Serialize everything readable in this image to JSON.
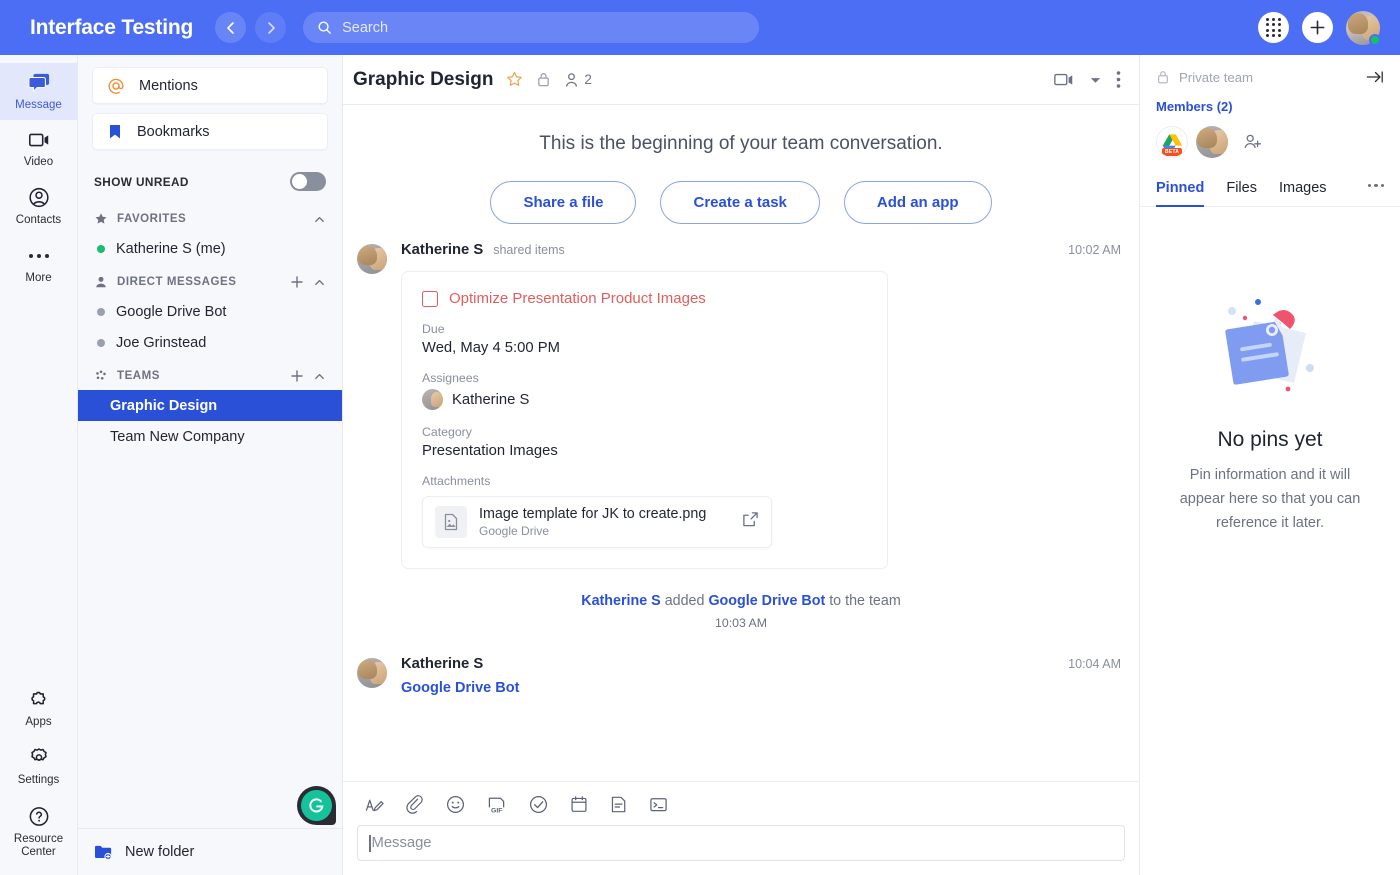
{
  "topbar": {
    "brand": "Interface Testing",
    "back_icon": "chevron-left-icon",
    "forward_icon": "chevron-right-icon",
    "search_placeholder": "Search",
    "search_value": "",
    "search_icon": "search-icon",
    "dialpad_icon": "dialpad-icon",
    "add_icon": "plus-icon",
    "avatar_name": "user-avatar",
    "status": "online",
    "accent": "#4c6ef5"
  },
  "rail": {
    "items": [
      {
        "label": "Message",
        "icon": "message-icon",
        "active": true
      },
      {
        "label": "Video",
        "icon": "video-icon",
        "active": false
      },
      {
        "label": "Contacts",
        "icon": "contacts-icon",
        "active": false
      },
      {
        "label": "More",
        "icon": "more-dots-icon",
        "active": false
      }
    ],
    "bottom_items": [
      {
        "label": "Apps",
        "icon": "puzzle-icon"
      },
      {
        "label": "Settings",
        "icon": "gear-icon"
      },
      {
        "label": "Resource Center",
        "icon": "question-circle-icon"
      }
    ]
  },
  "sidebar": {
    "mentions_label": "Mentions",
    "mentions_icon": "at-sign-icon",
    "bookmarks_label": "Bookmarks",
    "bookmarks_icon": "bookmark-icon",
    "show_unread_label": "SHOW UNREAD",
    "show_unread_on": false,
    "groups": [
      {
        "title": "FAVORITES",
        "icon": "star-icon",
        "has_add": false,
        "items": [
          {
            "name": "Katherine S (me)",
            "presence": "online"
          }
        ]
      },
      {
        "title": "DIRECT MESSAGES",
        "icon": "person-icon",
        "has_add": true,
        "items": [
          {
            "name": "Google Drive Bot",
            "presence": "offline"
          },
          {
            "name": "Joe Grinstead",
            "presence": "offline"
          }
        ]
      }
    ],
    "teams_group": {
      "title": "TEAMS",
      "icon": "teams-icon",
      "has_add": true,
      "items": [
        {
          "name": "Graphic Design",
          "active": true
        },
        {
          "name": "Team New Company",
          "active": false
        }
      ]
    },
    "new_folder_label": "New folder",
    "new_folder_icon": "folder-plus-icon",
    "grammarly_icon": "grammarly-icon"
  },
  "main": {
    "title": "Graphic Design",
    "star_icon": "star-outline-icon",
    "lock_icon": "lock-icon",
    "members_icon": "person-icon",
    "member_count": "2",
    "video_icon": "video-camera-icon",
    "caret_icon": "caret-down-icon",
    "overflow_icon": "kebab-menu-icon",
    "intro_text": "This is the beginning of your team conversation.",
    "intro_buttons": [
      "Share a file",
      "Create a task",
      "Add an app"
    ],
    "messages": [
      {
        "type": "task",
        "author": "Katherine S",
        "subtitle": "shared items",
        "time": "10:02 AM",
        "task": {
          "title": "Optimize Presentation Product Images",
          "checked": false,
          "due_label": "Due",
          "due_value": "Wed, May 4 5:00 PM",
          "assignees_label": "Assignees",
          "assignee_name": "Katherine S",
          "category_label": "Category",
          "category_value": "Presentation Images",
          "attachments_label": "Attachments",
          "attachment_name": "Image template for JK to create.png",
          "attachment_source": "Google Drive",
          "attachment_open_icon": "external-link-icon",
          "attachment_file_icon": "image-file-icon",
          "title_color": "#e35d5d"
        }
      },
      {
        "type": "system",
        "actor": "Katherine S",
        "verb": "added",
        "target": "Google Drive Bot",
        "tail": "to the team",
        "time": "10:03 AM"
      },
      {
        "type": "text",
        "author": "Katherine S",
        "time": "10:04 AM",
        "text": "Google Drive Bot"
      }
    ],
    "composer": {
      "placeholder": "Message",
      "value": "",
      "tools": [
        "text-format-icon",
        "paperclip-icon",
        "emoji-icon",
        "gif-icon",
        "task-check-icon",
        "calendar-icon",
        "document-icon",
        "code-snippet-icon"
      ]
    }
  },
  "right_panel": {
    "privacy_label": "Private team",
    "privacy_icon": "lock-icon",
    "collapse_icon": "collapse-right-icon",
    "members_title": "Members (2)",
    "members": [
      {
        "name": "Google Drive Bot",
        "type": "gdrive",
        "badge": "BETA"
      },
      {
        "name": "Katherine S",
        "type": "photo",
        "badge": ""
      }
    ],
    "add_member_icon": "add-person-icon",
    "tabs": [
      {
        "label": "Pinned",
        "active": true
      },
      {
        "label": "Files",
        "active": false
      },
      {
        "label": "Images",
        "active": false
      }
    ],
    "more_icon": "more-dots-icon",
    "empty_illustration": "pinned-note-illustration",
    "empty_title": "No pins yet",
    "empty_desc": "Pin information and it will appear here so that you can reference it later."
  }
}
